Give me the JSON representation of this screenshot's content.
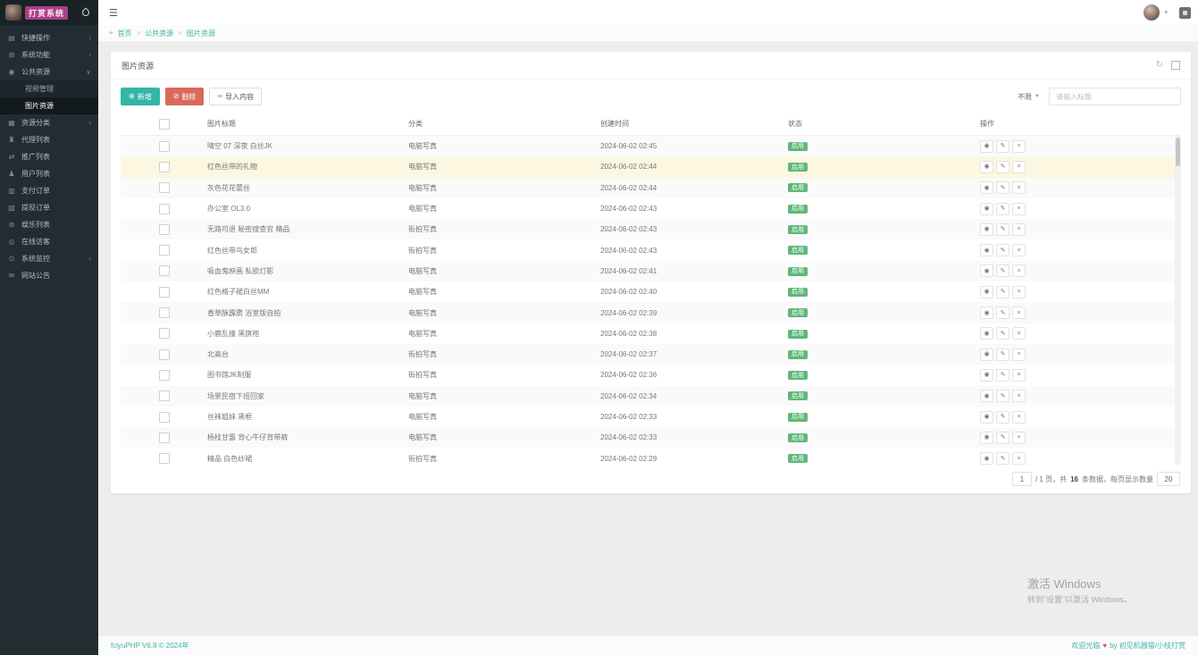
{
  "app": {
    "title": "打赏系统",
    "accent_color": "#35b5a5",
    "danger_color": "#d9695c",
    "success_color": "#5eb878",
    "brand_color": "#a83f87"
  },
  "sidebar": {
    "items": [
      {
        "label": "快捷操作",
        "icon": "folder-icon",
        "glyph": "▤",
        "chevron": "‹"
      },
      {
        "label": "系统功能",
        "icon": "wrench-icon",
        "glyph": "⊞",
        "chevron": "‹"
      },
      {
        "label": "公共资源",
        "icon": "camera-icon",
        "glyph": "◉",
        "chevron": "∨",
        "open": true,
        "children": [
          {
            "label": "视频管理",
            "active": false
          },
          {
            "label": "图片资源",
            "active": true
          }
        ]
      },
      {
        "label": "资源分类",
        "icon": "grid-icon",
        "glyph": "▦",
        "chevron": "‹"
      },
      {
        "label": "代理列表",
        "icon": "agents-icon",
        "glyph": "♜"
      },
      {
        "label": "推广列表",
        "icon": "share-icon",
        "glyph": "⇄"
      },
      {
        "label": "用户列表",
        "icon": "user-icon",
        "glyph": "♟"
      },
      {
        "label": "支付订单",
        "icon": "payment-icon",
        "glyph": "▥"
      },
      {
        "label": "提现订单",
        "icon": "withdraw-icon",
        "glyph": "▧"
      },
      {
        "label": "娱乐列表",
        "icon": "entertainment-icon",
        "glyph": "⊛"
      },
      {
        "label": "在线访客",
        "icon": "visitors-icon",
        "glyph": "◎"
      },
      {
        "label": "系统监控",
        "icon": "monitor-icon",
        "glyph": "⊙",
        "chevron": "‹"
      },
      {
        "label": "网站公告",
        "icon": "announcement-icon",
        "glyph": "✉"
      }
    ]
  },
  "topbar": {
    "hamburger": "☰",
    "user_caret": "▾"
  },
  "breadcrumb": {
    "pin": "⌖",
    "items": [
      "首页",
      "公共资源",
      "图片资源"
    ],
    "separator": ">"
  },
  "panel": {
    "title": "图片资源",
    "refresh_glyph": "↻"
  },
  "toolbar": {
    "add_label": "新增",
    "add_glyph": "⊕",
    "delete_label": "删除",
    "delete_glyph": "⊘",
    "import_label": "导入内容",
    "import_glyph": "∞",
    "filter_label": "不限",
    "filter_caret": "▼",
    "search_placeholder": "请输入标题"
  },
  "table": {
    "headers": {
      "title": "图片标题",
      "category": "分类",
      "created": "创建时间",
      "status": "状态",
      "actions": "操作"
    },
    "action_glyphs": {
      "view": "◉",
      "edit": "✎",
      "delete": "×"
    },
    "rows": [
      {
        "title": "晴空 07 深夜 白丝JK",
        "category": "电脑写真",
        "created": "2024-06-02 02:45",
        "status": "启用",
        "highlight": false
      },
      {
        "title": "红色丝带的礼物",
        "category": "电脑写真",
        "created": "2024-06-02 02:44",
        "status": "启用",
        "highlight": true
      },
      {
        "title": "灰色花花蕾丝",
        "category": "电脑写真",
        "created": "2024-06-02 02:44",
        "status": "启用",
        "highlight": false
      },
      {
        "title": "办公室 OL3.0",
        "category": "电脑写真",
        "created": "2024-06-02 02:43",
        "status": "启用",
        "highlight": false
      },
      {
        "title": "无路可退 秘密搜查官 精品",
        "category": "街拍写真",
        "created": "2024-06-02 02:43",
        "status": "启用",
        "highlight": false
      },
      {
        "title": "红色丝带鸟女郎",
        "category": "街拍写真",
        "created": "2024-06-02 02:43",
        "status": "启用",
        "highlight": false
      },
      {
        "title": "吸血鬼映画 私欲灯影",
        "category": "电脑写真",
        "created": "2024-06-02 02:41",
        "status": "启用",
        "highlight": false
      },
      {
        "title": "红色格子裙白丝MM",
        "category": "电脑写真",
        "created": "2024-06-02 02:40",
        "status": "启用",
        "highlight": false
      },
      {
        "title": "香草酥霹雳 浴室版自拍",
        "category": "电脑写真",
        "created": "2024-06-02 02:39",
        "status": "启用",
        "highlight": false
      },
      {
        "title": "小鹿乱撞 黑旗袍",
        "category": "电脑写真",
        "created": "2024-06-02 02:38",
        "status": "启用",
        "highlight": false
      },
      {
        "title": "北高台",
        "category": "街拍写真",
        "created": "2024-06-02 02:37",
        "status": "启用",
        "highlight": false
      },
      {
        "title": "图书馆JK制服",
        "category": "街拍写真",
        "created": "2024-06-02 02:36",
        "status": "启用",
        "highlight": false
      },
      {
        "title": "场景民宿下班回家",
        "category": "电脑写真",
        "created": "2024-06-02 02:34",
        "status": "启用",
        "highlight": false
      },
      {
        "title": "丝袜姐妹 黑框",
        "category": "电脑写真",
        "created": "2024-06-02 02:33",
        "status": "启用",
        "highlight": false
      },
      {
        "title": "杨枝甘露 背心牛仔背带裤",
        "category": "电脑写真",
        "created": "2024-06-02 02:33",
        "status": "启用",
        "highlight": false
      },
      {
        "title": "精品 白色纱裙",
        "category": "街拍写真",
        "created": "2024-06-02 02:29",
        "status": "启用",
        "highlight": false
      }
    ]
  },
  "pagination": {
    "current_page": "1",
    "info_prefix": "/ 1 页，共",
    "total": "16",
    "info_suffix": "条数据，每页显示数量",
    "per_page": "20"
  },
  "watermark": {
    "line1": "激活 Windows",
    "line2": "转到“设置”以激活 Windows。"
  },
  "footer": {
    "left": "fciyuPHP V6.8 © 2024年",
    "right_prefix": "欢迎光临",
    "heart": "♥",
    "right_suffix": "by 初见机器猫/小枝打赏"
  }
}
